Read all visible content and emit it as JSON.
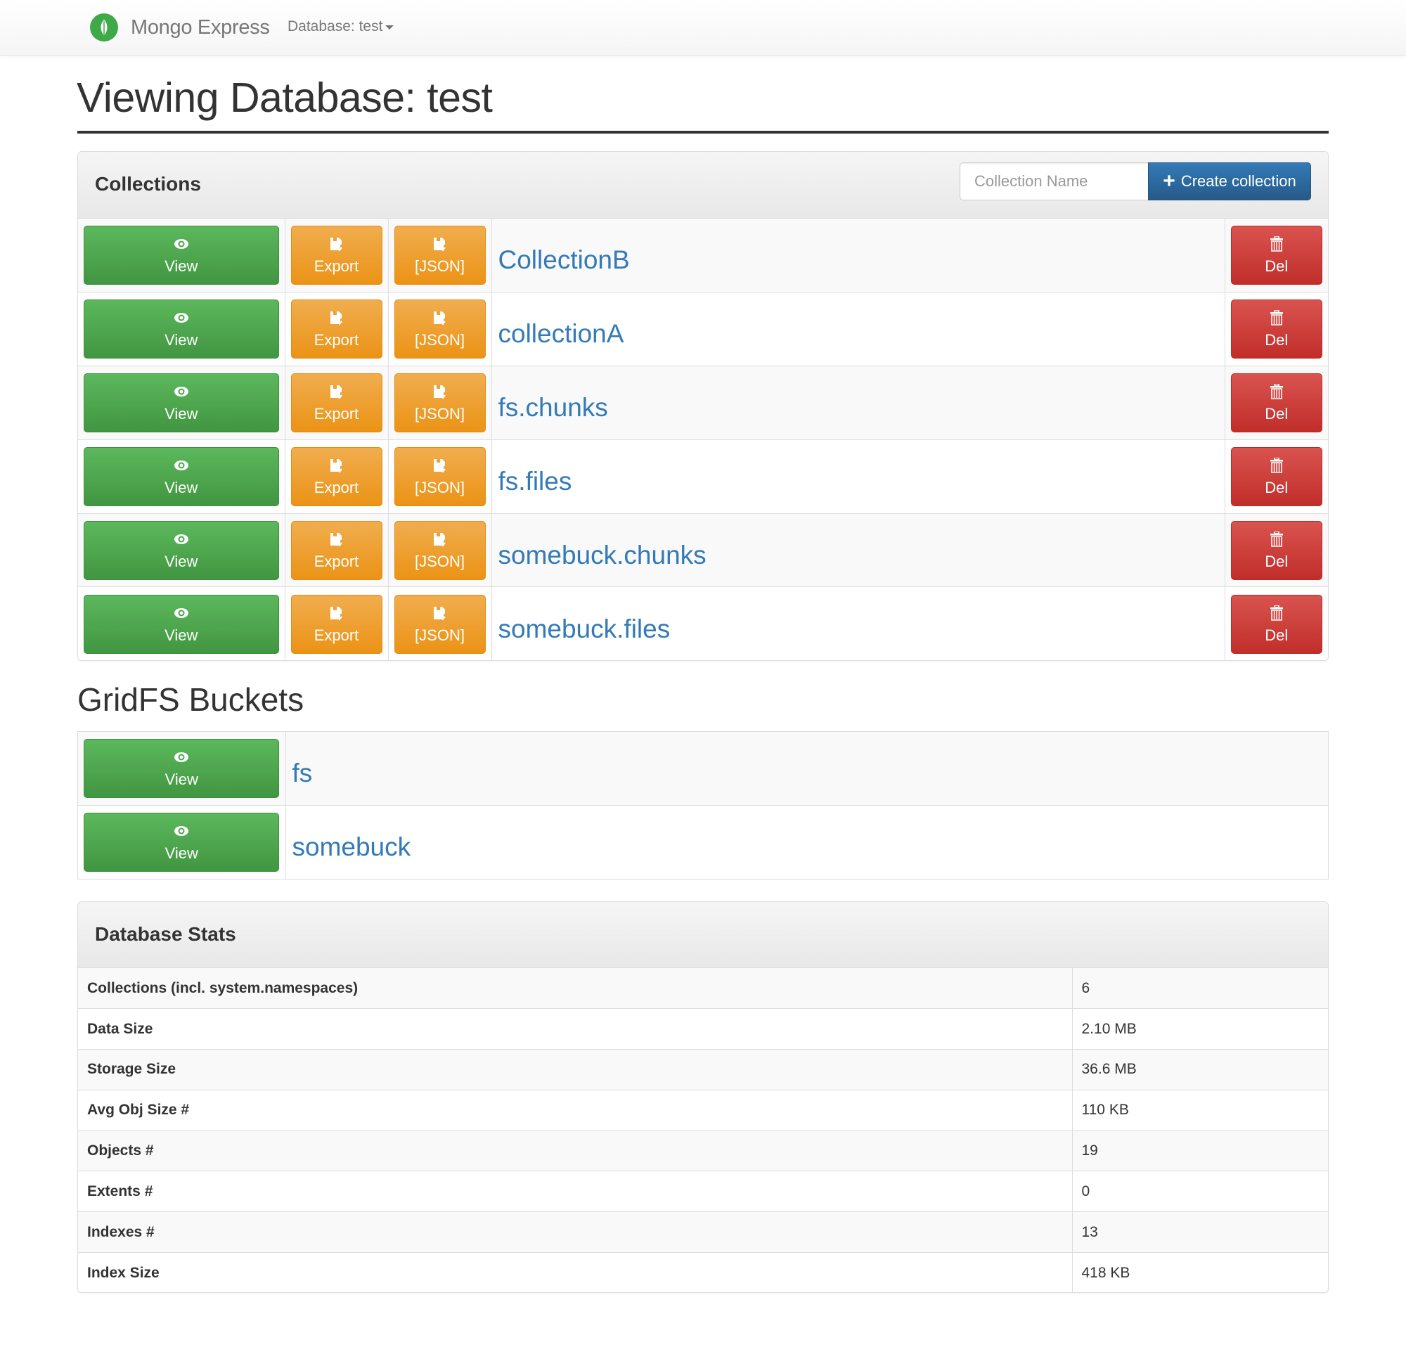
{
  "navbar": {
    "brand": "Mongo Express",
    "database_dropdown": "Database: test",
    "logo_icon": "mongodb-leaf-icon",
    "brand_color": "#3fa948"
  },
  "page": {
    "title": "Viewing Database: test"
  },
  "collections_panel": {
    "title": "Collections",
    "input_placeholder": "Collection Name",
    "input_value": "",
    "create_button": "Create collection",
    "create_icon": "plus-icon",
    "rows": [
      {
        "name": "CollectionB",
        "view": "View",
        "export": "Export",
        "json": "[JSON]",
        "delete": "Del"
      },
      {
        "name": "collectionA",
        "view": "View",
        "export": "Export",
        "json": "[JSON]",
        "delete": "Del"
      },
      {
        "name": "fs.chunks",
        "view": "View",
        "export": "Export",
        "json": "[JSON]",
        "delete": "Del"
      },
      {
        "name": "fs.files",
        "view": "View",
        "export": "Export",
        "json": "[JSON]",
        "delete": "Del"
      },
      {
        "name": "somebuck.chunks",
        "view": "View",
        "export": "Export",
        "json": "[JSON]",
        "delete": "Del"
      },
      {
        "name": "somebuck.files",
        "view": "View",
        "export": "Export",
        "json": "[JSON]",
        "delete": "Del"
      }
    ]
  },
  "gridfs": {
    "title": "GridFS Buckets",
    "rows": [
      {
        "name": "fs",
        "view": "View"
      },
      {
        "name": "somebuck",
        "view": "View"
      }
    ]
  },
  "stats_panel": {
    "title": "Database Stats",
    "rows": [
      {
        "label": "Collections (incl. system.namespaces)",
        "value": "6"
      },
      {
        "label": "Data Size",
        "value": "2.10 MB"
      },
      {
        "label": "Storage Size",
        "value": "36.6 MB"
      },
      {
        "label": "Avg Obj Size #",
        "value": "110 KB"
      },
      {
        "label": "Objects #",
        "value": "19"
      },
      {
        "label": "Extents #",
        "value": "0"
      },
      {
        "label": "Indexes #",
        "value": "13"
      },
      {
        "label": "Index Size",
        "value": "418 KB"
      }
    ]
  },
  "colors": {
    "primary": "#337ab7",
    "success": "#5cb85c",
    "warning": "#f0ad4e",
    "danger": "#d9534f"
  }
}
